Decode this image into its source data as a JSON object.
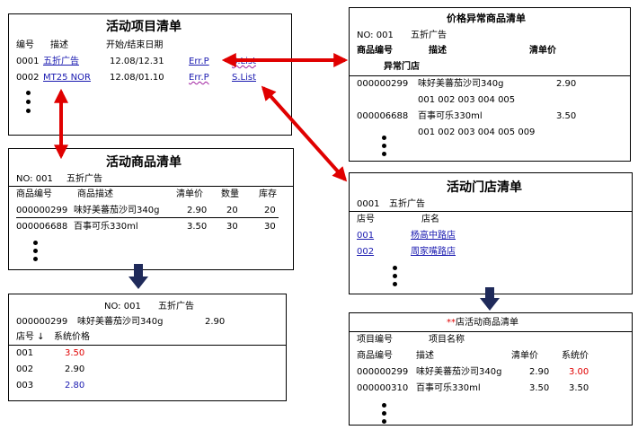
{
  "p1": {
    "title": "活动项目清单",
    "h_no": "编号",
    "h_desc": "描述",
    "h_date": "开始/结束日期",
    "rows": [
      {
        "no": "0001",
        "desc": "五折广告",
        "date": "12.08/12.31",
        "err": "Err.P",
        "list": "S.List"
      },
      {
        "no": "0002",
        "desc": "MT25 NOR",
        "date": "12.08/01.10",
        "err": "Err.P",
        "list": "S.List"
      }
    ]
  },
  "p2": {
    "title": "活动商品清单",
    "no_line": "NO: 001",
    "no_desc": "五折广告",
    "h_code": "商品编号",
    "h_desc": "商品描述",
    "h_price": "清单价",
    "h_qty": "数量",
    "h_stock": "库存",
    "rows": [
      {
        "code": "000000299",
        "desc": "味好美蕃茄沙司340g",
        "price": "2.90",
        "qty": "20",
        "stock": "20"
      },
      {
        "code": "000006688",
        "desc": "百事可乐330ml",
        "price": "3.50",
        "qty": "30",
        "stock": "30"
      }
    ]
  },
  "p3": {
    "no_line": "NO: 001",
    "no_desc": "五折广告",
    "prod_code": "000000299",
    "prod_desc": "味好美蕃茄沙司340g",
    "prod_price": "2.90",
    "h_store": "店号 ↓",
    "h_sys": "系统价格",
    "rows": [
      {
        "store": "001",
        "price": "3.50",
        "color": "#e00000"
      },
      {
        "store": "002",
        "price": "2.90",
        "color": "#000000"
      },
      {
        "store": "003",
        "price": "2.80",
        "color": "#1a1ab0"
      }
    ]
  },
  "p4": {
    "title": "价格异常商品清单",
    "no_line": "NO: 001",
    "no_desc": "五折广告",
    "h_code": "商品编号",
    "h_desc": "描述",
    "h_price": "清单价",
    "h_store": "异常门店",
    "rows": [
      {
        "code": "000000299",
        "desc": "味好美蕃茄沙司340g",
        "price": "2.90",
        "stores": "001  002  003  004  005"
      },
      {
        "code": "000006688",
        "desc": "百事可乐330ml",
        "price": "3.50",
        "stores": "001  002  003  004  005  009"
      }
    ]
  },
  "p5": {
    "title": "活动门店清单",
    "no_line": "0001",
    "no_desc": "五折广告",
    "h_store": "店号",
    "h_name": "店名",
    "rows": [
      {
        "store": "001",
        "name": "杨高中路店"
      },
      {
        "store": "002",
        "name": "周家嘴路店"
      }
    ]
  },
  "p6": {
    "title_prefix": "**",
    "title": "店活动商品清单",
    "h_proj_no": "项目编号",
    "h_proj_name": "项目名称",
    "h_code": "商品编号",
    "h_desc": "描述",
    "h_price": "清单价",
    "h_sys": "系统价",
    "rows": [
      {
        "code": "000000299",
        "desc": "味好美蕃茄沙司340g",
        "price": "2.90",
        "sys": "3.00",
        "sys_color": "#e00000"
      },
      {
        "code": "000000310",
        "desc": "百事可乐330ml",
        "price": "3.50",
        "sys": "3.50",
        "sys_color": "#000000"
      }
    ]
  },
  "colors": {
    "arrow_red": "#e00000",
    "arrow_navy": "#1f2a5a",
    "link": "#1a1ab0"
  }
}
